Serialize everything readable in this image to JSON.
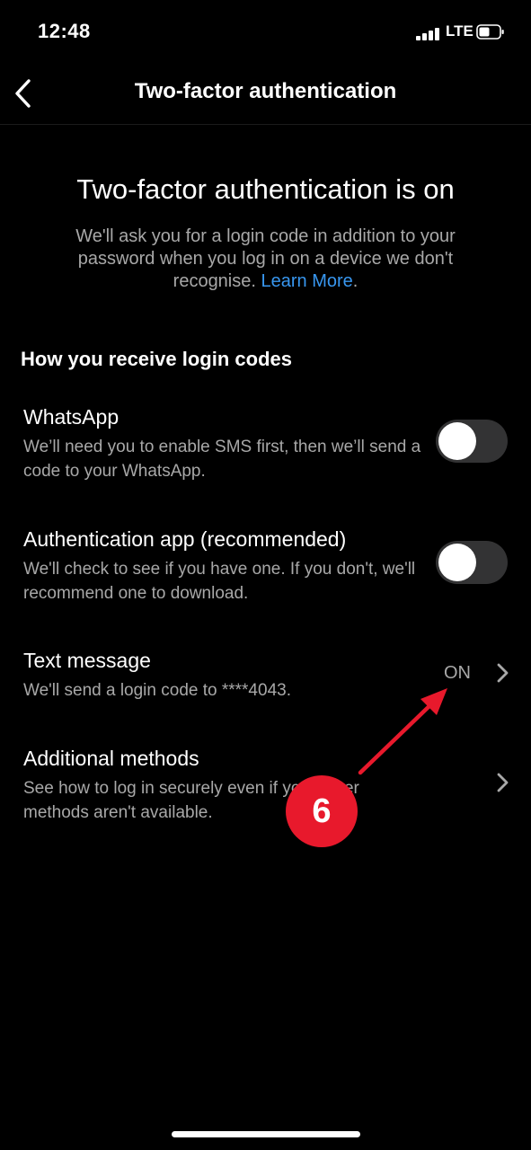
{
  "status_bar": {
    "time": "12:48",
    "network": "LTE",
    "icons": [
      "signal-icon",
      "battery-icon"
    ]
  },
  "header": {
    "title": "Two-factor authentication",
    "back_icon": "chevron-left-icon"
  },
  "intro": {
    "title": "Two-factor authentication is on",
    "description": "We'll ask you for a login code in addition to your password when you log in on a device we don't recognise.",
    "learn_more": "Learn More",
    "period": "."
  },
  "section": {
    "title": "How you receive login codes"
  },
  "methods": [
    {
      "title": "WhatsApp",
      "description": "We’ll need you to enable SMS first, then we’ll send a code to your WhatsApp.",
      "control": "toggle",
      "enabled": false
    },
    {
      "title": "Authentication app (recommended)",
      "description": "We'll check to see if you have one. If you don't, we'll recommend one to download.",
      "control": "toggle",
      "enabled": false
    },
    {
      "title": "Text message",
      "description": "We'll send a login code to ****4043.",
      "control": "chevron",
      "value": "ON"
    },
    {
      "title": "Additional methods",
      "description": "See how to log in securely even if your other methods aren't available.",
      "control": "chevron"
    }
  ],
  "annotation": {
    "badge": "6"
  },
  "colors": {
    "background": "#000000",
    "text_primary": "#ffffff",
    "text_secondary": "#a8a8a8",
    "link": "#3897f0",
    "toggle_off": "#333334",
    "annotation": "#e8192c"
  }
}
